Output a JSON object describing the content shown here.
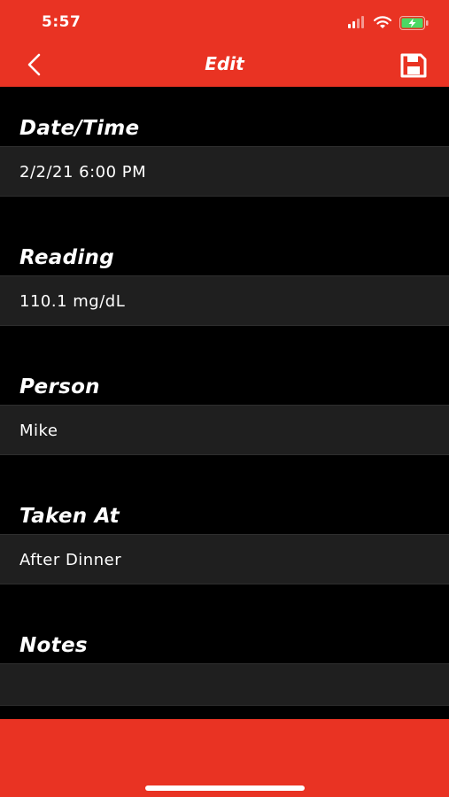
{
  "status": {
    "time": "5:57",
    "signal_icon": "cellular-signal-icon",
    "wifi_icon": "wifi-icon",
    "battery_icon": "battery-charging-icon"
  },
  "nav": {
    "title": "Edit",
    "back_icon": "chevron-left-icon",
    "save_icon": "floppy-disk-icon"
  },
  "fields": [
    {
      "label": "Date/Time",
      "value": "2/2/21 6:00 PM"
    },
    {
      "label": "Reading",
      "value": "110.1 mg/dL"
    },
    {
      "label": "Person",
      "value": "Mike"
    },
    {
      "label": "Taken At",
      "value": "After Dinner"
    },
    {
      "label": "Notes",
      "value": ""
    }
  ],
  "colors": {
    "accent": "#e93323",
    "background": "#000000",
    "field_background": "#1f1f1f",
    "battery_green": "#4cd964"
  }
}
